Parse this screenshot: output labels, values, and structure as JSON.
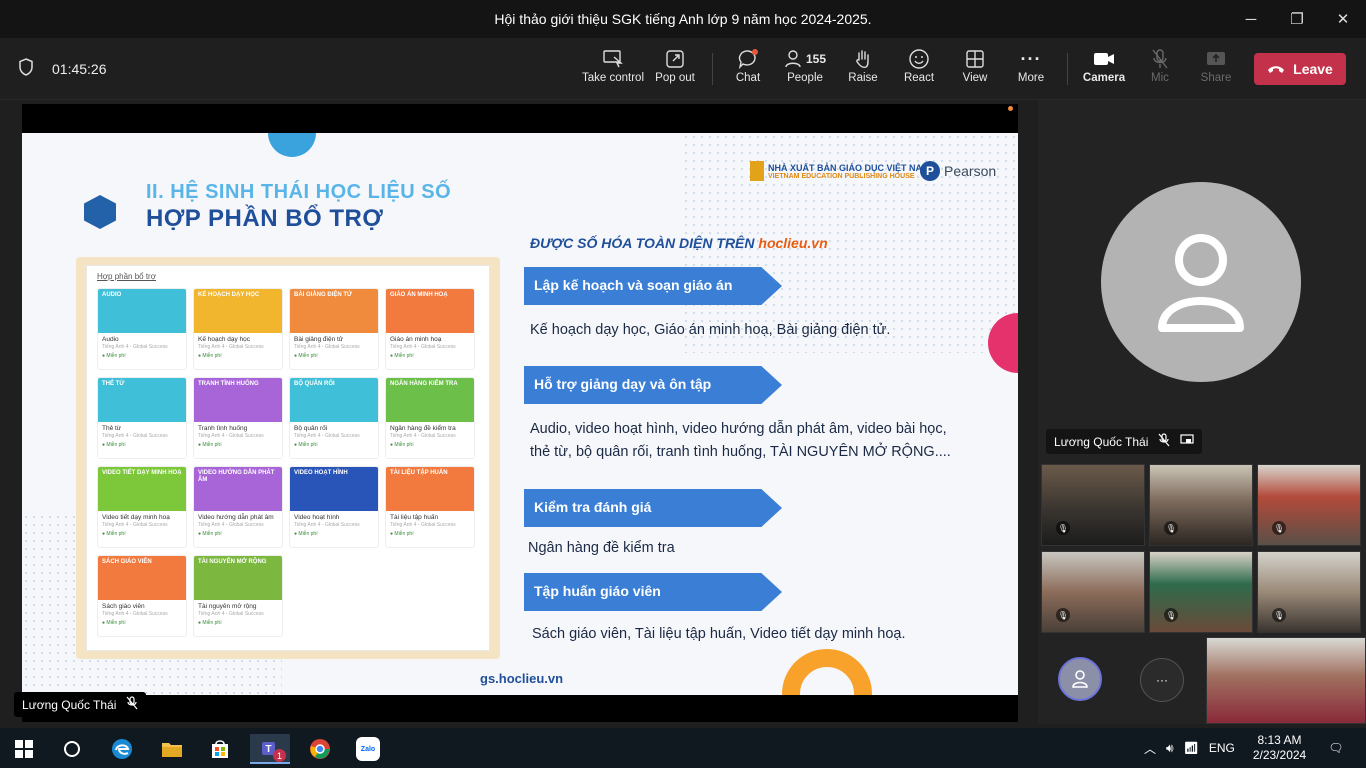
{
  "window": {
    "title": "Hội thảo giới thiệu SGK tiếng Anh lớp 9 năm học 2024-2025.",
    "minimize": "─",
    "maximize": "❐",
    "close": "✕"
  },
  "meeting": {
    "timer": "01:45:26"
  },
  "toolbar": {
    "take_control": "Take control",
    "pop_out": "Pop out",
    "chat": "Chat",
    "people": "People",
    "people_count": "155",
    "raise": "Raise",
    "react": "React",
    "view": "View",
    "more": "More",
    "camera": "Camera",
    "mic": "Mic",
    "share": "Share",
    "leave": "Leave"
  },
  "slide": {
    "section_title": "II. HỆ SINH THÁI HỌC LIỆU SỐ",
    "main_title": "HỢP PHẦN BỔ TRỢ",
    "publisher_line1": "NHÀ XUẤT BẢN GIÁO DỤC VIỆT NAM",
    "publisher_line2": "VIETNAM EDUCATION PUBLISHING HOUSE",
    "pearson": "Pearson",
    "subtitle": "ĐƯỢC SỐ HÓA TOÀN DIỆN TRÊN",
    "subtitle_link": "hoclieu.vn",
    "items": [
      {
        "heading": "Lập kế hoạch và soạn giáo án",
        "desc": "Kế hoạch dạy học, Giáo án minh hoạ, Bài giảng điện tử."
      },
      {
        "heading": "Hỗ trợ giảng dạy và ôn tập",
        "desc": "Audio, video hoạt hình, video hướng dẫn phát âm, video bài học,",
        "desc2": "thẻ từ, bộ quân rối, tranh tình huống, TÀI NGUYÊN MỞ RỘNG...."
      },
      {
        "heading": "Kiểm tra đánh giá",
        "desc": "Ngân hàng đề kiểm tra"
      },
      {
        "heading": "Tập huấn giáo viên",
        "desc": "Sách giáo viên, Tài liệu tập huấn, Video tiết dạy minh hoạ."
      }
    ],
    "footer_url": "gs.hoclieu.vn",
    "panel": {
      "header": "Hợp phần bổ trợ",
      "subtext": "Tiếng Anh 4 - Global Success",
      "free": "● Miễn phí",
      "cards": [
        {
          "tag": "AUDIO",
          "name": "Audio",
          "color": "#3fc0d8"
        },
        {
          "tag": "KẾ HOẠCH DẠY HỌC",
          "name": "Kế hoạch dạy học",
          "color": "#f2b52e"
        },
        {
          "tag": "BÀI GIẢNG ĐIỆN TỬ",
          "name": "Bài giảng điện tử",
          "color": "#f08a3c"
        },
        {
          "tag": "GIÁO ÁN MINH HOẠ",
          "name": "Giáo án minh hoạ",
          "color": "#f27a3e"
        },
        {
          "tag": "THẺ TỪ",
          "name": "Thẻ từ",
          "color": "#3fc0d8"
        },
        {
          "tag": "TRANH TÌNH HUỐNG",
          "name": "Tranh tình huống",
          "color": "#a865d8"
        },
        {
          "tag": "BỘ QUÂN RỐI",
          "name": "Bộ quân rối",
          "color": "#3fc0d8"
        },
        {
          "tag": "NGÂN HÀNG KIỂM TRA",
          "name": "Ngân hàng đề kiểm tra",
          "color": "#6cc04a"
        },
        {
          "tag": "VIDEO TIẾT DẠY MINH HOẠ",
          "name": "Video tiết dạy minh hoạ",
          "color": "#7cc83a"
        },
        {
          "tag": "VIDEO HƯỚNG DẪN PHÁT ÂM",
          "name": "Video hướng dẫn phát âm",
          "color": "#a865d8"
        },
        {
          "tag": "VIDEO HOẠT HÌNH",
          "name": "Video hoạt hình",
          "color": "#2a55b8"
        },
        {
          "tag": "TÀI LIỆU TẬP HUẤN",
          "name": "Tài liệu tập huấn",
          "color": "#f27a3e"
        },
        {
          "tag": "SÁCH GIÁO VIÊN",
          "name": "Sách giáo viên",
          "color": "#f27a3e"
        },
        {
          "tag": "TÀI NGUYÊN MỞ RỘNG",
          "name": "Tài nguyên mở rộng",
          "color": "#7cb840"
        }
      ]
    }
  },
  "presenter": {
    "name": "Lương Quốc Thái"
  },
  "participant_main": {
    "name": "Lương Quốc Thái"
  },
  "taskbar": {
    "teams_badge": "1",
    "zalo": "Zalo",
    "lang": "ENG",
    "time": "8:13 AM",
    "date": "2/23/2024"
  }
}
